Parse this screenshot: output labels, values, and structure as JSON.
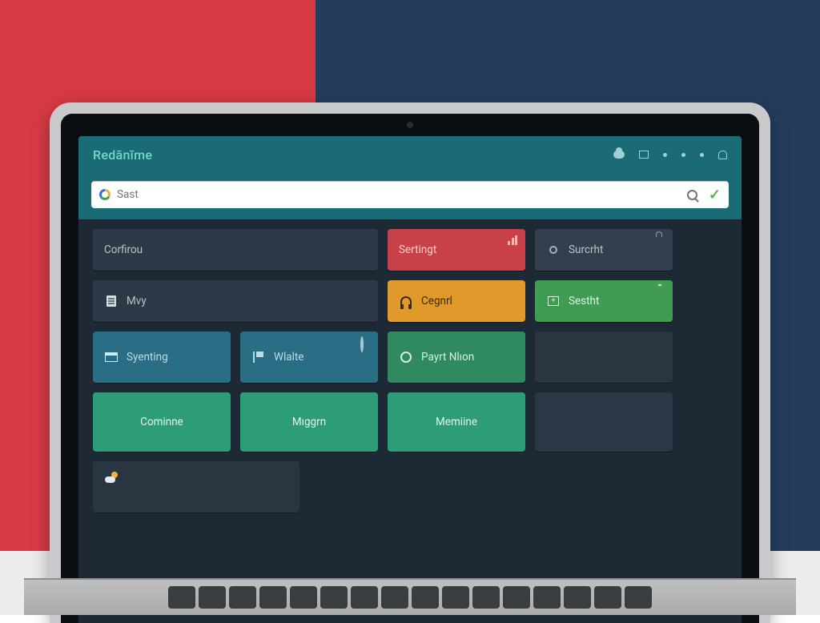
{
  "colors": {
    "bg_left": "#d83a44",
    "bg_right": "#253d5c",
    "header": "#1b6b77",
    "screen": "#1d2a36"
  },
  "header": {
    "brand": "Redānīme",
    "icons": [
      "cloud",
      "window",
      "dot",
      "dot",
      "dot",
      "bell"
    ]
  },
  "search": {
    "placeholder": "Sast",
    "value": "",
    "right_icons": [
      "magnify",
      "check"
    ]
  },
  "rows": {
    "r1": {
      "a": {
        "label": "Corfirou",
        "color": "slate",
        "icon": ""
      },
      "b": {
        "label": "Sertingt",
        "color": "red",
        "corner": "stats"
      },
      "c": {
        "label": "Surcrht",
        "color": "slate2",
        "icon": "pin",
        "corner": "lock"
      }
    },
    "r2": {
      "a": {
        "label": "Mvy",
        "color": "slate",
        "icon": "doc"
      },
      "b": {
        "label": "Cegnrl",
        "color": "orange",
        "icon": "headset"
      },
      "c": {
        "label": "Sestht",
        "color": "green",
        "icon": "cal",
        "corner": "chat"
      }
    },
    "r3": {
      "a": {
        "label": "Syenting",
        "color": "blue",
        "icon": "window"
      },
      "b": {
        "label": "Wlalte",
        "color": "blue",
        "icon": "flag",
        "corner": "pin"
      },
      "c": {
        "label": "Payrt Nlıon",
        "color": "dgreen",
        "icon": "gear"
      },
      "side": {
        "label": "",
        "color": "night",
        "icon": "lines"
      }
    },
    "r4": {
      "a": {
        "label": "Cominne",
        "color": "tealg"
      },
      "b": {
        "label": "Mıggrn",
        "color": "tealg"
      },
      "c": {
        "label": "Memiine",
        "color": "tealg"
      },
      "side": {
        "label": "",
        "color": "night2"
      }
    },
    "r5": {
      "a": {
        "label": "",
        "color": "night",
        "icon": "cloudsun"
      }
    }
  }
}
